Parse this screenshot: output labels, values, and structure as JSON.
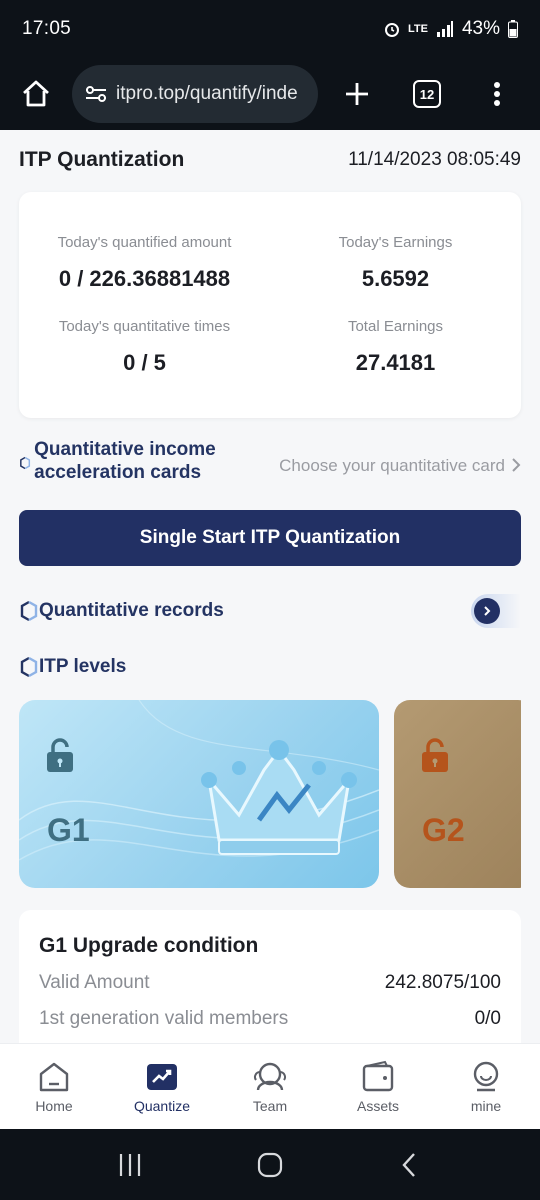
{
  "status_bar": {
    "time": "17:05",
    "network": "LTE",
    "battery": "43%"
  },
  "browser": {
    "url": "itpro.top/quantify/inde",
    "tab_count": "12"
  },
  "header": {
    "title": "ITP Quantization",
    "datetime": "11/14/2023 08:05:49"
  },
  "stats": {
    "quantified_amount_label": "Today's quantified amount",
    "quantified_amount_value": "0 / 226.36881488",
    "earnings_label": "Today's Earnings",
    "earnings_value": "5.6592",
    "times_label": "Today's quantitative times",
    "times_value": "0 / 5",
    "total_label": "Total Earnings",
    "total_value": "27.4181"
  },
  "accel": {
    "title": "Quantitative income acceleration cards",
    "choose": "Choose your quantitative card"
  },
  "start_button": "Single Start ITP Quantization",
  "records_label": "Quantitative records",
  "levels_label": "ITP levels",
  "level_cards": [
    {
      "name": "G1",
      "color": "#3f6f82"
    },
    {
      "name": "G2",
      "color": "#b5541c"
    }
  ],
  "upgrade": {
    "title": "G1 Upgrade condition",
    "rows": [
      {
        "label": "Valid Amount",
        "value": "242.8075/100"
      },
      {
        "label": "1st generation valid members",
        "value": "0/0"
      }
    ]
  },
  "nav": [
    {
      "label": "Home",
      "icon": "home-icon"
    },
    {
      "label": "Quantize",
      "icon": "chart-icon"
    },
    {
      "label": "Team",
      "icon": "team-icon"
    },
    {
      "label": "Assets",
      "icon": "wallet-icon"
    },
    {
      "label": "mine",
      "icon": "user-icon"
    }
  ],
  "colors": {
    "primary": "#223064",
    "accent_text": "#243463"
  }
}
